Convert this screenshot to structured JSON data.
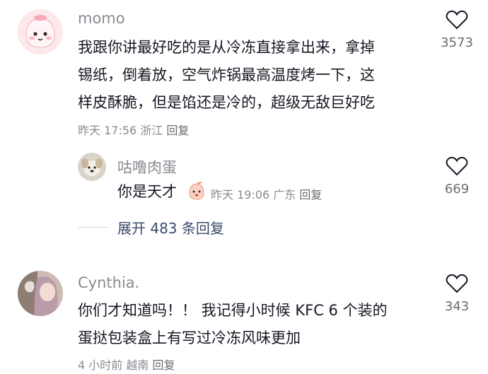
{
  "comments": [
    {
      "username": "momo",
      "lines": [
        "我跟你讲最好吃的是从冷冻直接拿出来，拿掉",
        "锡纸，倒着放，空气炸锅最高温度烤一下，这",
        "样皮酥脆，但是馅还是冷的，超级无敌巨好吃"
      ],
      "time": "昨天 17:56",
      "location": "浙江",
      "reply": "回复",
      "likes": "3573"
    },
    {
      "username": "咕噜肉蛋",
      "text": "你是天才",
      "time": "昨天 19:06",
      "location": "广东",
      "reply": "回复",
      "likes": "669"
    },
    {
      "username": "Cynthia.",
      "lines": [
        "你们才知道吗！！ 我记得小时候 KFC 6 个装的",
        "蛋挞包装盒上有写过冷冻风味更加"
      ],
      "time": "4 小时前",
      "location": "越南",
      "reply": "回复",
      "likes": "343"
    }
  ],
  "expand_replies": "展开 483 条回复"
}
